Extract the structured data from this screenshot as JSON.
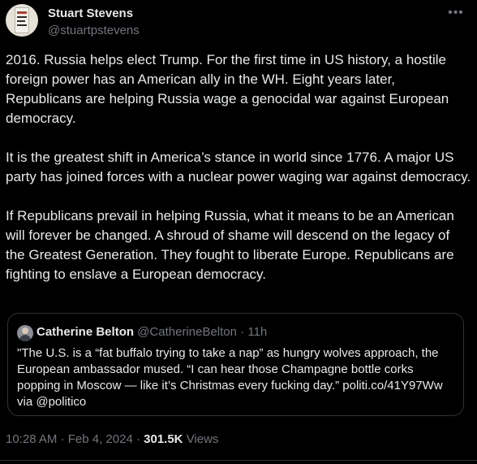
{
  "author": {
    "name": "Stuart Stevens",
    "handle": "@stuartpstevens"
  },
  "more_icon": "•••",
  "tweet": {
    "paragraphs": [
      "2016. Russia helps elect Trump. For the first time in US history, a hostile foreign power has an American ally in the WH. Eight years later, Republicans are helping Russia wage a genocidal war against European democracy.",
      "It is the greatest shift in America’s stance in world since 1776. A major US party has joined forces with a nuclear power waging war against democracy.",
      "If Republicans prevail in helping Russia, what it means to be an American will forever be changed. A shroud of shame will descend on the legacy of the Greatest Generation. They fought to liberate Europe. Republicans are fighting to enslave a European democracy."
    ]
  },
  "quote": {
    "name": "Catherine Belton",
    "handle": "@CatherineBelton",
    "separator": "·",
    "time": "11h",
    "text": "\"The U.S. is a “fat buffalo trying to take a nap” as hungry wolves approach, the European ambassador mused. “I can hear those Champagne bottle corks popping in Moscow — like it’s Christmas every fucking day.” politi.co/41Y97Ww via @politico"
  },
  "meta": {
    "time": "10:28 AM",
    "date": "Feb 4, 2024",
    "separator": "·",
    "views_count": "301.5K",
    "views_label": "Views"
  },
  "colors": {
    "background": "#000000",
    "text_primary": "#e7e9ea",
    "text_secondary": "#71767b",
    "border": "#2f3336"
  }
}
